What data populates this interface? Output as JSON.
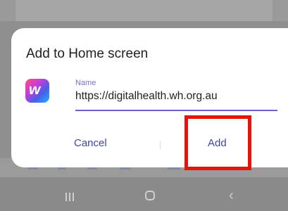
{
  "dialog": {
    "title": "Add to Home screen",
    "name_label": "Name",
    "name_value": "https://digitalhealth.wh.org.au",
    "icon_glyph": "w",
    "icon_colors": [
      "#ff4e7a",
      "#c93dd6",
      "#4a5de8",
      "#1fb3ff"
    ],
    "cancel_label": "Cancel",
    "add_label": "Add"
  },
  "highlight": {
    "color": "#e8120c",
    "target": "add-button"
  },
  "navbar": {
    "recent_icon": "recent-apps-icon",
    "home_icon": "home-icon",
    "back_icon": "back-icon"
  },
  "colors": {
    "accent": "#6b61c9",
    "button_text": "#3d46a8",
    "scrim": "#8f8f8f"
  }
}
